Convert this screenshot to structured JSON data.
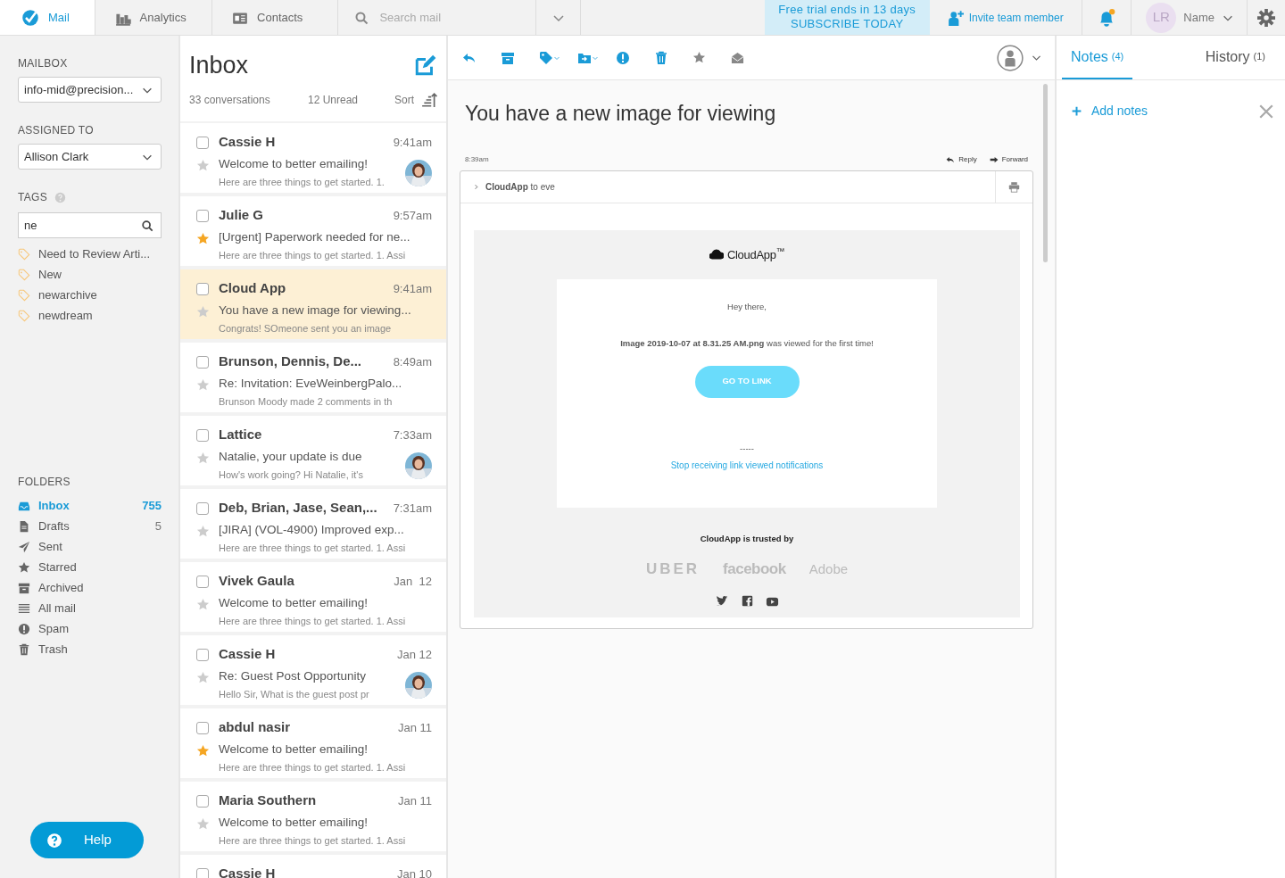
{
  "topbar": {
    "tabs": [
      {
        "label": "Mail",
        "selected": true
      },
      {
        "label": "Analytics",
        "selected": false
      },
      {
        "label": "Contacts",
        "selected": false
      }
    ],
    "search": {
      "placeholder": "Search mail"
    },
    "trial": {
      "line1": "Free trial ends in 13 days",
      "line2": "SUBSCRIBE TODAY"
    },
    "invite": "Invite team member",
    "notifications_unread": true,
    "user_initials": "LR",
    "user_name": "Name"
  },
  "sidebar": {
    "mailbox_label": "MAILBOX",
    "mailbox": "info-mid@precision...",
    "assigned_label": "ASSIGNED TO",
    "assigned": "Allison Clark",
    "tags_label": "TAGS",
    "tag_search": "ne",
    "tags": [
      "Need to Review Arti...",
      "New",
      "newarchive",
      "newdream"
    ],
    "folders_label": "FOLDERS",
    "folders": [
      {
        "label": "Inbox",
        "count": "755",
        "selected": true
      },
      {
        "label": "Drafts",
        "count": "5",
        "selected": false
      },
      {
        "label": "Sent",
        "selected": false
      },
      {
        "label": "Starred",
        "selected": false
      },
      {
        "label": "Archived",
        "selected": false
      },
      {
        "label": "All mail",
        "selected": false
      },
      {
        "label": "Spam",
        "selected": false
      },
      {
        "label": "Trash",
        "selected": false
      }
    ],
    "help": "Help"
  },
  "inbox": {
    "title": "Inbox",
    "conversations": "33 conversations",
    "unread": "12 Unread",
    "sort": "Sort",
    "messages": [
      {
        "sender": "Cassie H",
        "time": "9:41am",
        "subject": "Welcome to better emailing!",
        "preview": "Here are three things to get started. 1.",
        "starred": false,
        "checked": false,
        "selected": false,
        "avatar": true
      },
      {
        "sender": "Julie G",
        "time": "9:57am",
        "subject": "[Urgent] Paperwork needed for ne...",
        "preview": "Here are three things to get started. 1. Assi",
        "starred": true,
        "checked": false,
        "selected": false,
        "avatar": false
      },
      {
        "sender": "Cloud App",
        "time": "9:41am",
        "subject": "You have a new image for viewing...",
        "preview": "Congrats! SOmeone sent you an image",
        "starred": false,
        "checked": false,
        "selected": true,
        "avatar": false
      },
      {
        "sender": "Brunson, Dennis, De...",
        "time": "8:49am",
        "subject": "Re: Invitation: EveWeinbergPalo...",
        "preview": "Brunson Moody made 2 comments in th",
        "starred": false,
        "checked": false,
        "selected": false,
        "avatar": false
      },
      {
        "sender": "Lattice",
        "time": "7:33am",
        "subject": "Natalie, your update is due",
        "preview": "How's work going? Hi Natalie, it's",
        "starred": false,
        "checked": false,
        "selected": false,
        "avatar": true
      },
      {
        "sender": "Deb, Brian, Jase, Sean,...",
        "time": "7:31am",
        "subject": "[JIRA] (VOL-4900) Improved exp...",
        "preview": "Here are three things to get started. 1. Assi",
        "starred": false,
        "checked": false,
        "selected": false,
        "avatar": false
      },
      {
        "sender": "Vivek Gaula",
        "time": "Jan  12",
        "subject": "Welcome to better emailing!",
        "preview": "Here are three things to get started. 1. Assi",
        "starred": false,
        "checked": false,
        "selected": false,
        "avatar": false
      },
      {
        "sender": "Cassie H",
        "time": "Jan 12",
        "subject": "Re: Guest Post Opportunity",
        "preview": "Hello Sir, What is the guest  post pr",
        "starred": false,
        "checked": false,
        "selected": false,
        "avatar": true
      },
      {
        "sender": "abdul nasir",
        "time": "Jan 11",
        "subject": "Welcome to better emailing!",
        "preview": "Here are three things to get started. 1. Assi",
        "starred": true,
        "checked": false,
        "selected": false,
        "avatar": false
      },
      {
        "sender": "Maria Southern",
        "time": "Jan 11",
        "subject": "Welcome to better emailing!",
        "preview": "Here are three things to get started. 1. Assi",
        "starred": false,
        "checked": false,
        "selected": false,
        "avatar": false
      },
      {
        "sender": "Cassie H",
        "time": "Jan 10",
        "checked": false,
        "selected": false
      }
    ]
  },
  "reader": {
    "subject": "You have a new image for viewing",
    "time": "8:39am",
    "reply": "Reply",
    "forward": "Forward",
    "from": "**CloudApp** to eve",
    "email": {
      "brand": "CloudApp$^{™}$",
      "greeting": "Hey there,",
      "message": "**Image 2019-10-07 at 8.31.25 AM.png** was viewed for the first time!",
      "button": "GO TO LINK",
      "separator": "-----",
      "unsubscribe": "Stop receiving link viewed notifications",
      "trusted": "CloudApp is trusted by",
      "logos": [
        "UBER",
        "facebook",
        "Adobe"
      ]
    }
  },
  "notes": {
    "tabs": [
      {
        "label": "Notes",
        "count": "(4)",
        "selected": true
      },
      {
        "label": "History",
        "count": "(1)",
        "selected": false
      }
    ],
    "add": "Add notes"
  }
}
